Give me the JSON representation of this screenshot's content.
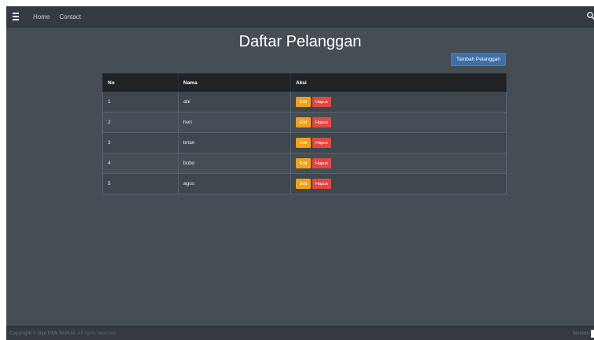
{
  "navbar": {
    "menu_icon": "hamburger-icon",
    "links": [
      "Home",
      "Contact"
    ],
    "search_icon": "search-icon"
  },
  "page": {
    "title": "Daftar Pelanggan",
    "add_button": "Tambah Pelanggan"
  },
  "table": {
    "headers": [
      "No",
      "Nama",
      "Aksi"
    ],
    "rows": [
      {
        "no": "1",
        "nama": "abi"
      },
      {
        "no": "2",
        "nama": "heri"
      },
      {
        "no": "3",
        "nama": "brian"
      },
      {
        "no": "4",
        "nama": "bobo"
      },
      {
        "no": "5",
        "nama": "agus"
      }
    ],
    "edit_label": "Edit",
    "delete_label": "Hapus"
  },
  "footer": {
    "copyright_prefix": "Copyright © ",
    "brand": "Bye USN PAPUA",
    "copyright_suffix": ". All rights reserved.",
    "version_label": "Version"
  },
  "colors": {
    "background": "#454d55",
    "navbar": "#343a40",
    "primary_button": "#3d6fa8",
    "edit_button": "#f0a01b",
    "delete_button": "#e04846"
  }
}
